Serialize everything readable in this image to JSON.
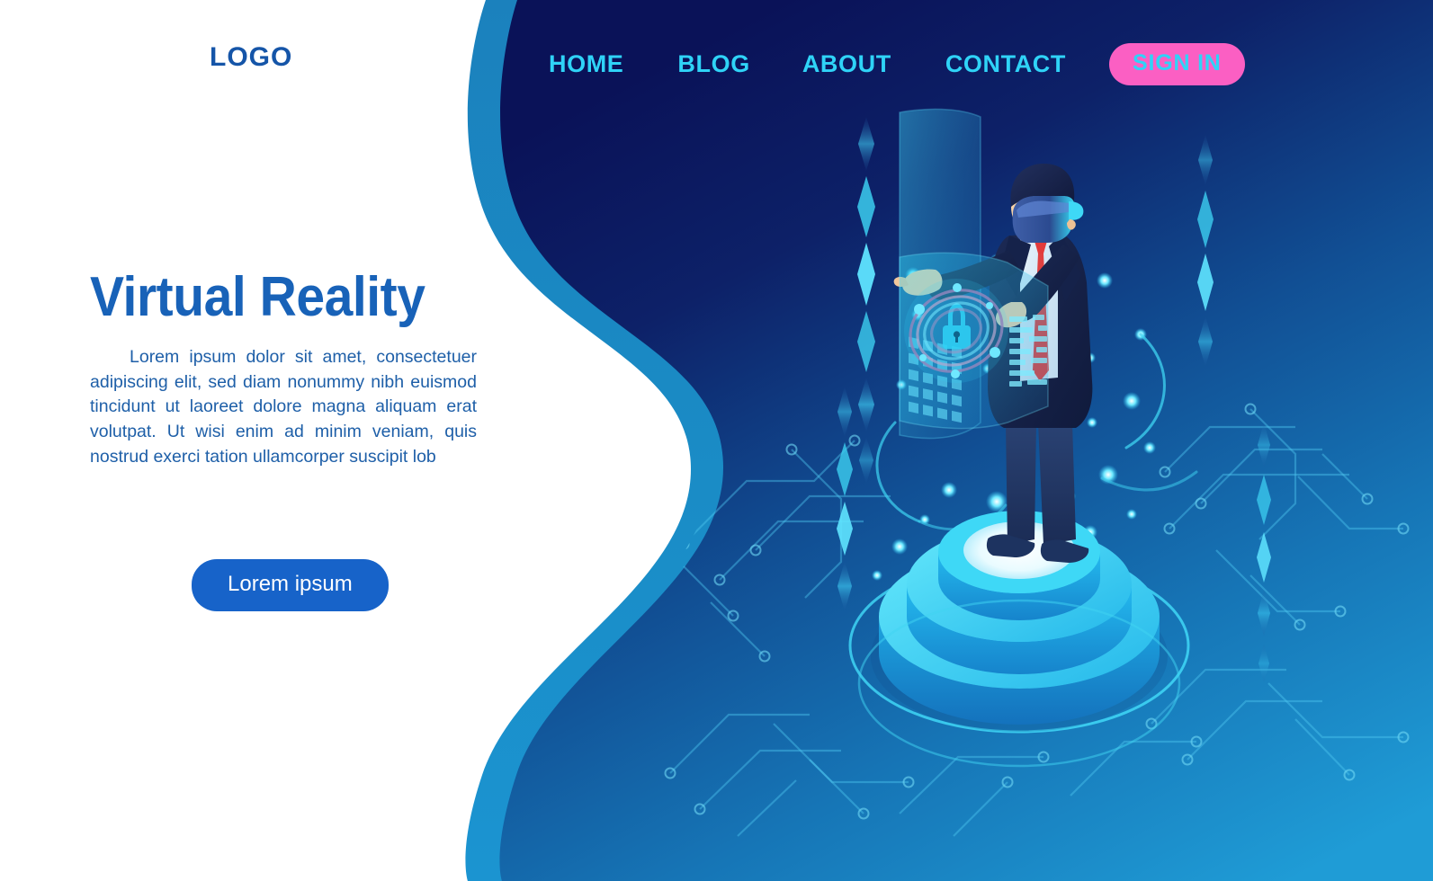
{
  "header": {
    "logo": "LOGO",
    "nav": [
      {
        "label": "HOME",
        "name": "nav-item-home"
      },
      {
        "label": "BLOG",
        "name": "nav-item-blog"
      },
      {
        "label": "ABOUT",
        "name": "nav-item-about"
      },
      {
        "label": "CONTACT",
        "name": "nav-item-contact"
      }
    ],
    "signin_label": "SIGN IN"
  },
  "hero": {
    "title": "Virtual Reality",
    "paragraph": "Lorem ipsum dolor sit amet, consectetuer adipiscing elit, sed diam nonummy nibh euismod tincidunt ut laoreet dolore magna aliquam erat volutpat. Ut wisi enim ad minim veniam, quis nostrud exerci tation ullamcorper suscipit lob",
    "cta_label": "Lorem ipsum"
  },
  "illustration": {
    "scene_name": "isometric-vr-user-on-podium",
    "figure": "man-wearing-vr-headset",
    "hologram_icon": "padlock-icon",
    "podium": "tiered-cyan-cylinder-platform",
    "background_motifs": [
      "circuit-traces",
      "diamond-particles",
      "glow-dots",
      "data-grid-screen"
    ]
  },
  "colors": {
    "white_panel": "#ffffff",
    "navy_dark": "#0b1660",
    "curve_stroke": "#1f86be",
    "blue_mid": "#13539f",
    "cyan_bright": "#2fd3f7",
    "cyan_light": "#49d8f5",
    "pink_accent": "#fb5fc3",
    "brand_blue": "#1555a8",
    "heading_blue": "#1862b8",
    "body_blue": "#1e5fa8",
    "cta_blue": "#1763c9",
    "bg_bottom_right": "#1b94d1",
    "ring_purple": "#8e86bd",
    "tie_red": "#e23b3b",
    "skin": "#f6d2a8"
  }
}
